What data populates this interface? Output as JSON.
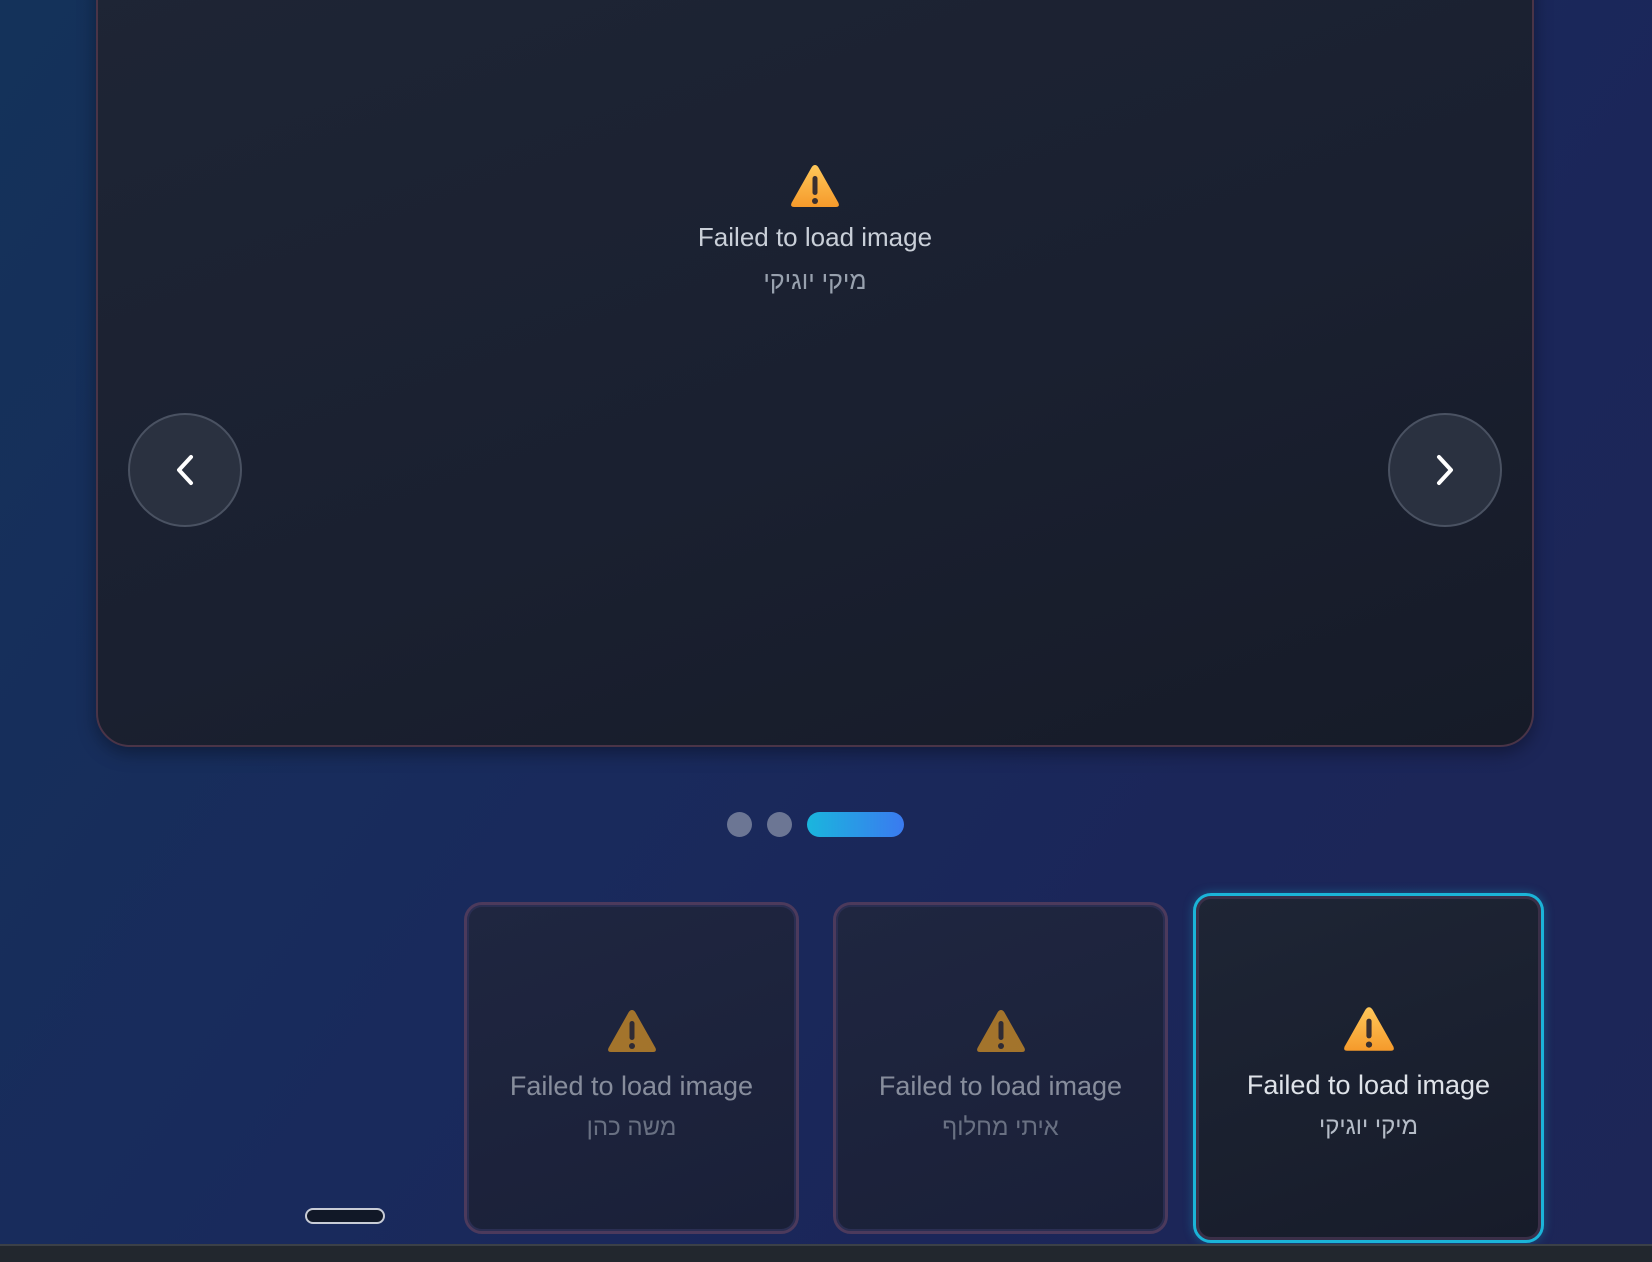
{
  "main_viewer": {
    "error_title": "Failed to load image",
    "error_name": "מיקי יוגיקי",
    "icon": "warning-icon"
  },
  "nav": {
    "prev_icon": "chevron-left-icon",
    "next_icon": "chevron-right-icon"
  },
  "pagination": {
    "count": 3,
    "active_index": 2
  },
  "thumbnails": [
    {
      "error_title": "Failed to load image",
      "error_name": "משה כהן",
      "selected": false
    },
    {
      "error_title": "Failed to load image",
      "error_name": "איתי מחלוף",
      "selected": false
    },
    {
      "error_title": "Failed to load image",
      "error_name": "מיקי יוגיקי",
      "selected": true
    }
  ],
  "colors": {
    "accent": "#1bb4d8",
    "accent_gradient_end": "#3a7af0",
    "warning": "#f5a623",
    "background": "#192a5c"
  }
}
